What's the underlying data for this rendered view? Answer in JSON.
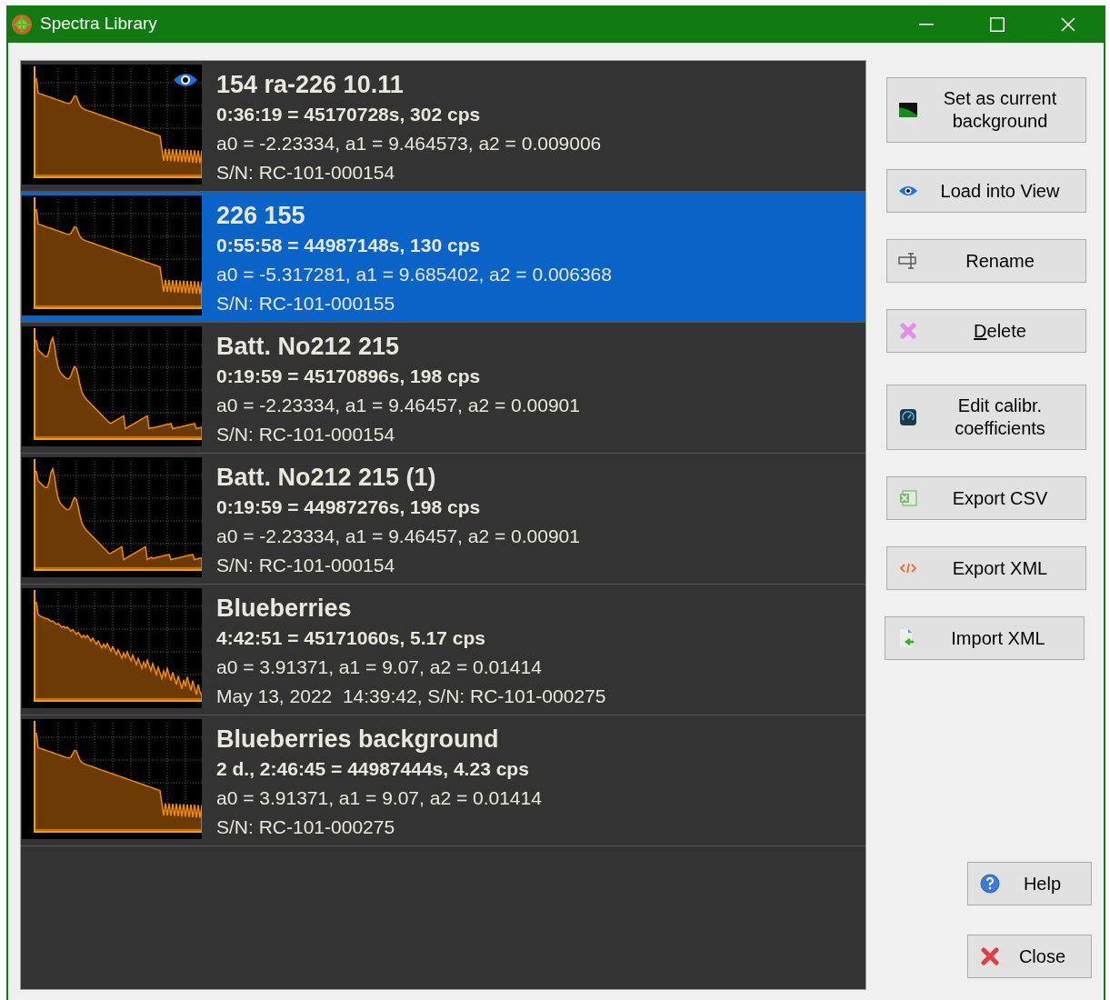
{
  "window": {
    "title": "Spectra Library"
  },
  "spectra": [
    {
      "name": "154 ra-226 10.11",
      "duration": "0:36:19 = 45170728s, 302 cps",
      "calibration": "a0 = -2.23334, a1 = 9.464573, a2 = 0.009006",
      "serial": "S/N: RC-101-000154",
      "in_view": true,
      "selected": false
    },
    {
      "name": "226 155",
      "duration": "0:55:58 = 44987148s, 130 cps",
      "calibration": "a0 = -5.317281, a1 = 9.685402, a2 = 0.006368",
      "serial": "S/N: RC-101-000155",
      "in_view": false,
      "selected": true
    },
    {
      "name": "Batt. No212 215",
      "duration": "0:19:59 = 45170896s, 198 cps",
      "calibration": "a0 = -2.23334, a1 = 9.46457, a2 = 0.00901",
      "serial": "S/N: RC-101-000154",
      "in_view": false,
      "selected": false
    },
    {
      "name": "Batt. No212 215 (1)",
      "duration": "0:19:59 = 44987276s, 198 cps",
      "calibration": "a0 = -2.23334, a1 = 9.46457, a2 = 0.00901",
      "serial": "S/N: RC-101-000154",
      "in_view": false,
      "selected": false
    },
    {
      "name": "Blueberries",
      "duration": "4:42:51 = 45171060s, 5.17 cps",
      "calibration": "a0 = 3.91371, a1 = 9.07, a2 = 0.01414",
      "serial": "May 13, 2022  14:39:42, S/N: RC-101-000275",
      "in_view": false,
      "selected": false
    },
    {
      "name": "Blueberries background",
      "duration": "2 d., 2:46:45 = 44987444s, 4.23 cps",
      "calibration": "a0 = 3.91371, a1 = 9.07, a2 = 0.01414",
      "serial": "S/N: RC-101-000275",
      "in_view": false,
      "selected": false
    }
  ],
  "actions": [
    {
      "kind": "background",
      "label": "Set as current background",
      "mnemonic": false
    },
    {
      "kind": "view",
      "label": "Load into View",
      "mnemonic": false
    },
    {
      "kind": "rename",
      "label": "Rename",
      "mnemonic": false
    },
    {
      "kind": "delete",
      "label": "Delete",
      "mnemonic": true
    },
    {
      "kind": "calibrate",
      "label": "Edit calibr. coefficients",
      "mnemonic": false
    },
    {
      "kind": "csv",
      "label": "Export CSV",
      "mnemonic": false
    },
    {
      "kind": "xml",
      "label": "Export XML",
      "mnemonic": false
    },
    {
      "kind": "import",
      "label": "Import XML",
      "mnemonic": false
    }
  ],
  "dialog_buttons": [
    {
      "kind": "help",
      "label": "Help"
    },
    {
      "kind": "close",
      "label": "Close"
    }
  ]
}
